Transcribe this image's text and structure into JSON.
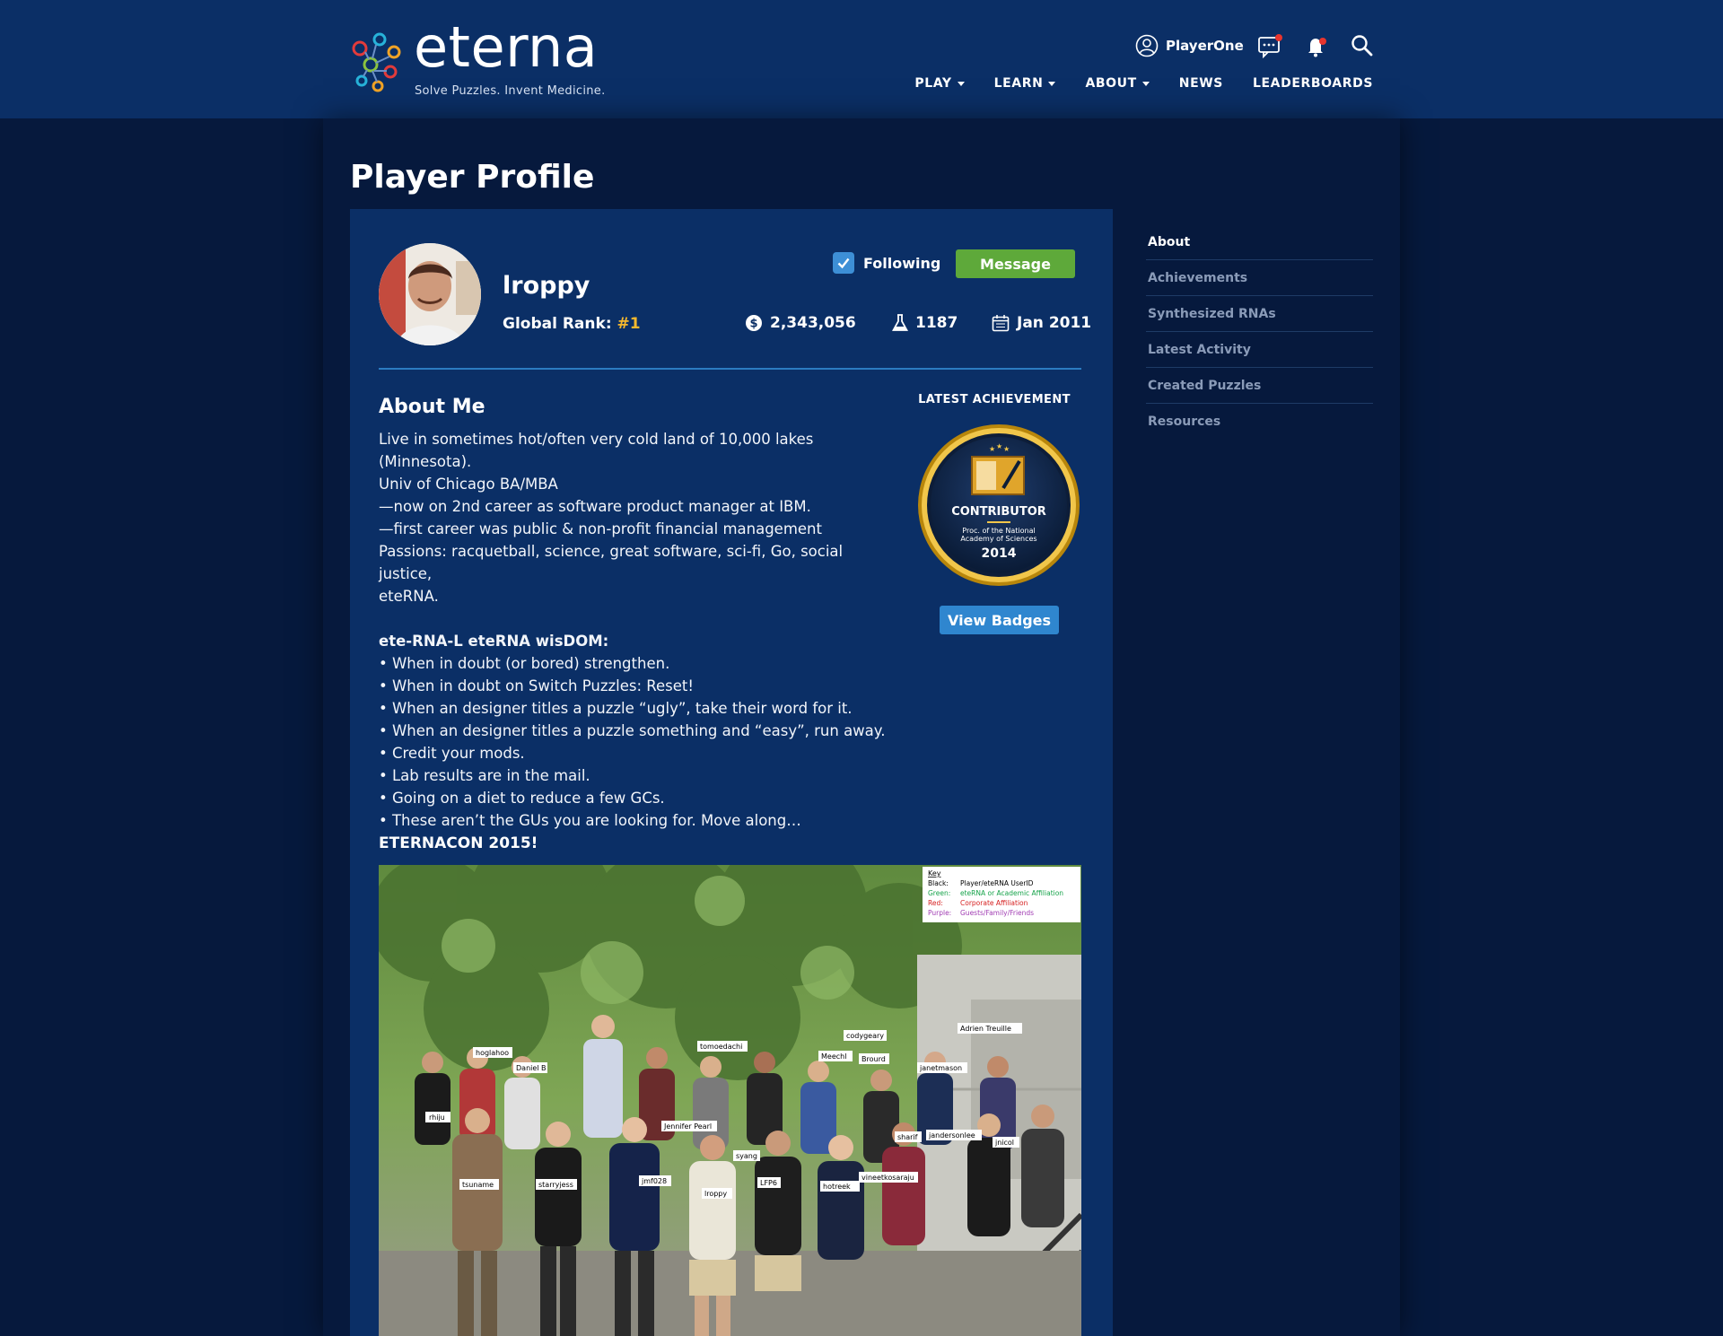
{
  "header": {
    "logo_word": "eterna",
    "logo_tagline": "Solve Puzzles. Invent Medicine.",
    "username": "PlayerOne",
    "icons": [
      "user-icon",
      "chat-icon",
      "bell-icon",
      "search-icon"
    ],
    "nav": [
      {
        "label": "PLAY",
        "dropdown": true
      },
      {
        "label": "LEARN",
        "dropdown": true
      },
      {
        "label": "ABOUT",
        "dropdown": true
      },
      {
        "label": "NEWS",
        "dropdown": false
      },
      {
        "label": "LEADERBOARDS",
        "dropdown": false
      }
    ]
  },
  "page": {
    "title": "Player Profile"
  },
  "profile": {
    "name": "lroppy",
    "rank_label": "Global Rank:",
    "rank_value": "#1",
    "following_label": "Following",
    "following_checked": true,
    "message_label": "Message",
    "points": "2,343,056",
    "labs": "1187",
    "joined": "Jan 2011"
  },
  "about": {
    "heading": "About Me",
    "lines": [
      "Live in sometimes hot/often very cold land of 10,000 lakes (Minnesota).",
      "Univ of Chicago BA/MBA",
      "—now on 2nd career as software product manager at IBM.",
      "—first career was public & non-profit financial management",
      "Passions: racquetball, science, great software, sci-fi, Go, social justice,",
      "eteRNA."
    ],
    "wisdom_heading": "ete-RNA-L eteRNA wisDOM:",
    "wisdom": [
      "• When in doubt (or bored) strengthen.",
      "• When in doubt on Switch Puzzles: Reset!",
      "• When an designer titles a puzzle “ugly”, take their word for it.",
      "• When an designer titles a puzzle something and “easy”, run away.",
      "• Credit your mods.",
      "• Lab results are in the mail.",
      "• Going on a diet to reduce a few GCs.",
      "• These aren’t the GUs you are looking for. Move along…"
    ],
    "eternacon_heading": "ETERNACON 2015!"
  },
  "achievement": {
    "label": "LATEST ACHIEVEMENT",
    "badge_title": "CONTRIBUTOR",
    "badge_line1": "Proc. of the National",
    "badge_line2": "Academy of Sciences",
    "badge_year": "2014",
    "view_badges_label": "View Badges"
  },
  "photo_labels": {
    "key_title": "Key",
    "key": [
      {
        "k": "Black:",
        "v": "Player/eteRNA UserID",
        "color": "#000000"
      },
      {
        "k": "Green:",
        "v": "eteRNA or Academic Affiliation",
        "color": "#16a34a"
      },
      {
        "k": "Red:",
        "v": "Corporate Affiliation",
        "color": "#d61f1f"
      },
      {
        "k": "Purple:",
        "v": "Guests/Family/Friends",
        "color": "#a13cb3"
      }
    ],
    "names": [
      "hoglahoo",
      "Daniel B",
      "rhiju",
      "tsuname",
      "starryjess",
      "jmf028",
      "lroppy",
      "LFP6",
      "hotreek",
      "Jennifer Pearl",
      "syang",
      "tomoedachi",
      "Meechl",
      "Brourd",
      "codygeary",
      "janetmason",
      "sharif",
      "jandersonlee",
      "jnicol",
      "vineetkosaraju",
      "Adrien Treuille"
    ]
  },
  "sidenav": [
    {
      "label": "About",
      "active": true
    },
    {
      "label": "Achievements",
      "active": false
    },
    {
      "label": "Synthesized RNAs",
      "active": false
    },
    {
      "label": "Latest Activity",
      "active": false
    },
    {
      "label": "Created Puzzles",
      "active": false
    },
    {
      "label": "Resources",
      "active": false
    }
  ],
  "colors": {
    "header_bg": "#0b2f66",
    "page_bg": "#06193d",
    "gold": "#f5b82e",
    "message_green": "#5ea93a",
    "badges_blue": "#2f86cf",
    "notify_red": "#e8352e"
  }
}
